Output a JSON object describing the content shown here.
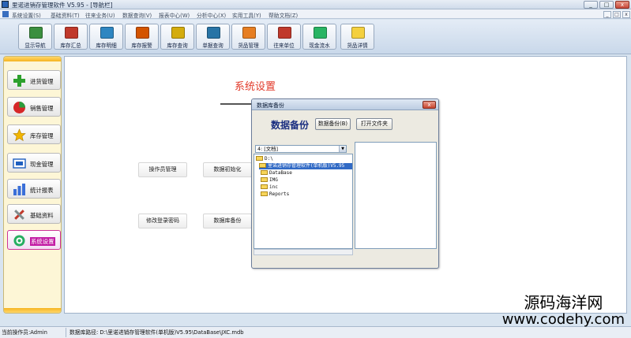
{
  "window": {
    "title": "里诺进销存管理软件 V5.95 - [导航栏]",
    "controls": [
      "_",
      "□",
      "x"
    ]
  },
  "menubar": {
    "items": [
      "系统设置(S)",
      "基础资料(T)",
      "往来业务(U)",
      "数据查询(V)",
      "报表中心(W)",
      "分析中心(X)",
      "实用工具(Y)",
      "帮助文档(Z)"
    ],
    "mdi_controls": [
      "_",
      "□",
      "x"
    ]
  },
  "toolbar": {
    "buttons": [
      {
        "label": "显示导航",
        "color": "#3b8f3f"
      },
      {
        "label": "库存汇总",
        "color": "#c0392b"
      },
      {
        "label": "库存明细",
        "color": "#2e86c1"
      },
      {
        "label": "库存报警",
        "color": "#d35400"
      },
      {
        "label": "库存查询",
        "color": "#d4ac0d"
      },
      {
        "label": "单据查询",
        "color": "#2874a6"
      },
      {
        "label": "货品管理",
        "color": "#e67e22"
      },
      {
        "label": "往来单位",
        "color": "#c0392b"
      },
      {
        "label": "现金流水",
        "color": "#28b463"
      },
      {
        "label": "货品详情",
        "color": "#f4d03f"
      }
    ]
  },
  "nav": {
    "items": [
      {
        "label": "进货管理",
        "icon": "plus-icon",
        "color": "#2ca02c",
        "active": false
      },
      {
        "label": "销售管理",
        "icon": "pie-chart-icon",
        "color": "#d62728",
        "active": false
      },
      {
        "label": "库存管理",
        "icon": "star-icon",
        "color": "#f2b600",
        "active": false
      },
      {
        "label": "现金管理",
        "icon": "cash-icon",
        "color": "#1f5fbf",
        "active": false
      },
      {
        "label": "统计报表",
        "icon": "bar-chart-icon",
        "color": "#3a6fd8",
        "active": false
      },
      {
        "label": "基础资料",
        "icon": "tools-icon",
        "color": "#c0392b",
        "active": false
      },
      {
        "label": "系统设置",
        "icon": "gear-icon",
        "color": "#27ae60",
        "active": true
      }
    ]
  },
  "main": {
    "title": "系统设置",
    "functions": {
      "operator_mgmt": "操作员管理",
      "data_init": "数据初始化",
      "change_password": "修改登录密码",
      "db_backup": "数据库备份"
    }
  },
  "dialog": {
    "title": "数据库备份",
    "heading": "数据备份",
    "backup_button": "数据备份(B)",
    "open_folder_button": "打开文件夹",
    "drive": "4: [文档]",
    "tree": [
      {
        "label": "D:\\",
        "selected": false,
        "indent": 0
      },
      {
        "label": "里诺进销存管理软件(单机版)V5.95",
        "selected": true,
        "indent": 1
      },
      {
        "label": "DataBase",
        "selected": false,
        "indent": 1
      },
      {
        "label": "IMG",
        "selected": false,
        "indent": 1
      },
      {
        "label": "inc",
        "selected": false,
        "indent": 1
      },
      {
        "label": "Reports",
        "selected": false,
        "indent": 1
      }
    ]
  },
  "status": {
    "operator": "当前操作员:Admin",
    "db_path": "数据库路径: D:\\里诺进销存管理软件(单机版)V5.95\\DataBase\\JXC.mdb"
  },
  "watermark": {
    "line1": "源码海洋网",
    "line2": "www.codehy.com"
  }
}
